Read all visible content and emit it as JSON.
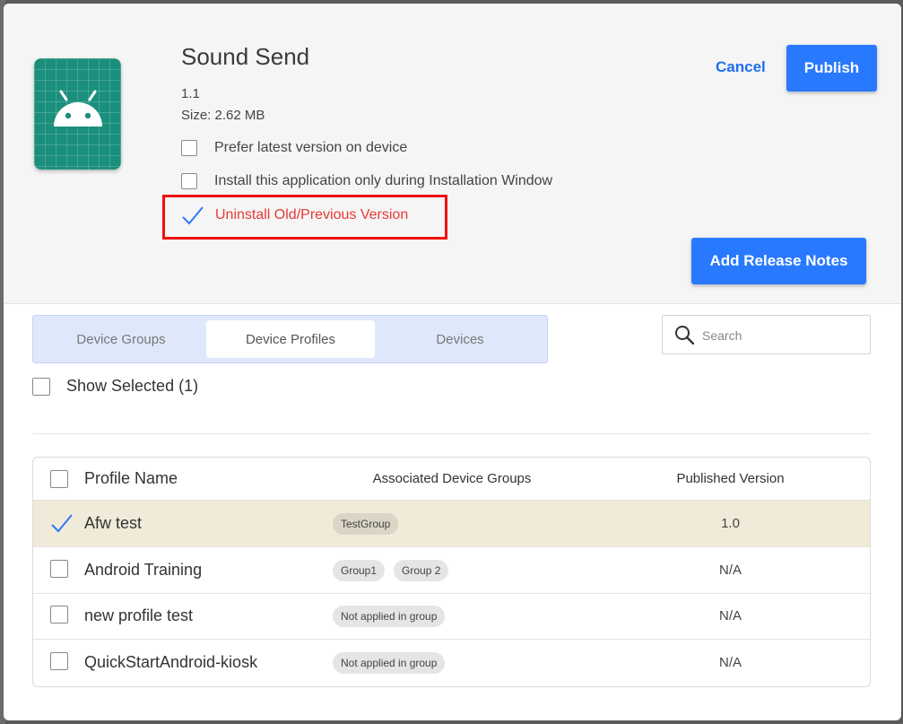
{
  "app": {
    "title": "Sound Send",
    "version": "1.1",
    "size": "Size: 2.62 MB",
    "icon": "android-robot-icon"
  },
  "options": [
    {
      "label": "Prefer latest version on device",
      "checked": false
    },
    {
      "label": "Install this application only during Installation Window",
      "checked": false
    },
    {
      "label": "Uninstall Old/Previous Version",
      "checked": true
    }
  ],
  "actions": {
    "cancel_label": "Cancel",
    "publish_label": "Publish",
    "release_notes_label": "Add Release Notes"
  },
  "tabs": [
    {
      "label": "Device Groups",
      "active": false
    },
    {
      "label": "Device Profiles",
      "active": true
    },
    {
      "label": "Devices",
      "active": false
    }
  ],
  "search": {
    "placeholder": "Search",
    "value": ""
  },
  "show_selected": {
    "label": "Show Selected (1)",
    "checked": false
  },
  "table": {
    "headers": {
      "name": "Profile Name",
      "groups": "Associated Device Groups",
      "version": "Published Version"
    },
    "rows": [
      {
        "name": "Afw test",
        "groups": [
          "TestGroup"
        ],
        "version": "1.0",
        "checked": true
      },
      {
        "name": "Android Training",
        "groups": [
          "Group1",
          "Group 2"
        ],
        "version": "N/A",
        "checked": false
      },
      {
        "name": "new profile test",
        "groups": [
          "Not applied in group"
        ],
        "version": "N/A",
        "checked": false
      },
      {
        "name": "QuickStartAndroid-kiosk",
        "groups": [
          "Not applied in group"
        ],
        "version": "N/A",
        "checked": false
      }
    ]
  },
  "colors": {
    "accent": "#2979ff",
    "danger": "#e53935",
    "selected_row": "#f0ead9",
    "app_icon_bg": "#1a8f7c"
  }
}
